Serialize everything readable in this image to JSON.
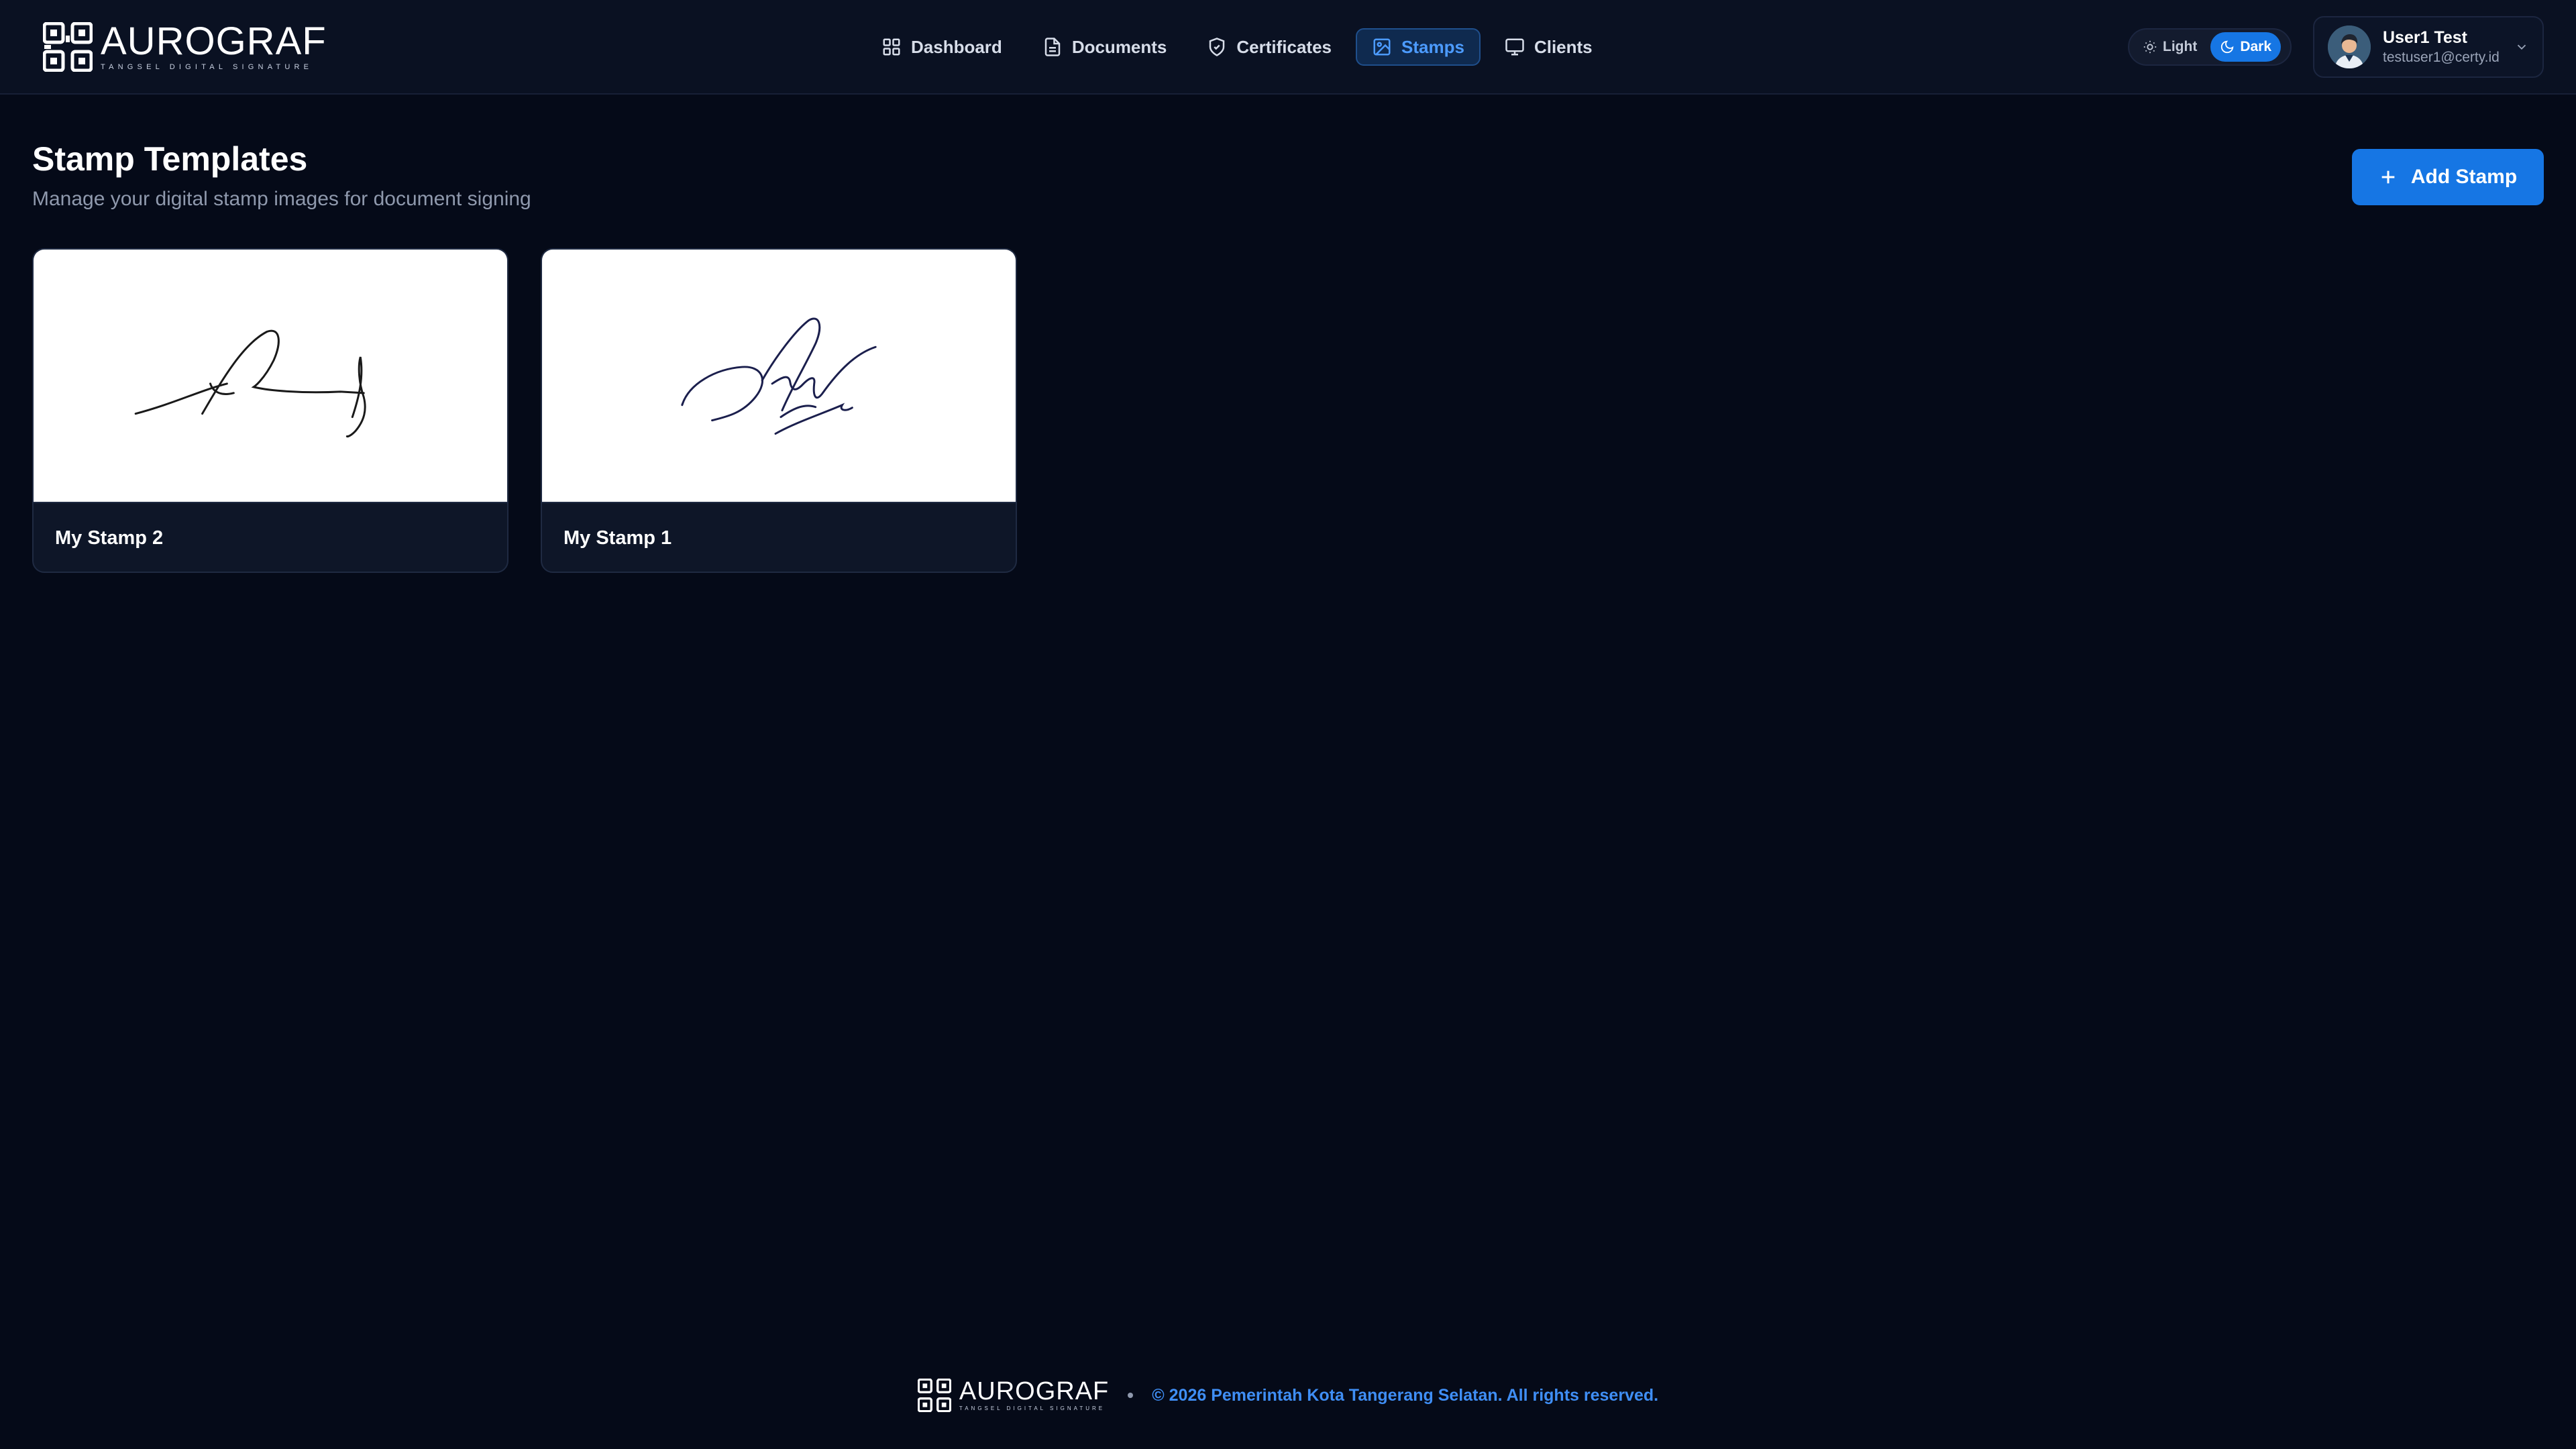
{
  "brand": {
    "name": "AUROGRAF",
    "tagline": "Tangsel Digital Signature"
  },
  "nav": {
    "items": [
      {
        "label": "Dashboard",
        "icon": "grid-icon"
      },
      {
        "label": "Documents",
        "icon": "document-icon"
      },
      {
        "label": "Certificates",
        "icon": "shield-icon"
      },
      {
        "label": "Stamps",
        "icon": "image-icon",
        "active": true
      },
      {
        "label": "Clients",
        "icon": "monitor-icon"
      }
    ]
  },
  "theme": {
    "light_label": "Light",
    "dark_label": "Dark",
    "selected": "Dark"
  },
  "user": {
    "name": "User1 Test",
    "email": "testuser1@certy.id"
  },
  "main": {
    "title": "Stamp Templates",
    "subtitle": "Manage your digital stamp images for document signing",
    "add_button_label": "Add Stamp",
    "stamps": [
      {
        "name": "My Stamp 2"
      },
      {
        "name": "My Stamp 1"
      }
    ]
  },
  "footer": {
    "copyright": "© 2026 Pemerintah Kota Tangerang Selatan. All rights reserved."
  },
  "colors": {
    "background": "#050a18",
    "accent": "#1676e4",
    "active_nav_text": "#4c9bff"
  }
}
